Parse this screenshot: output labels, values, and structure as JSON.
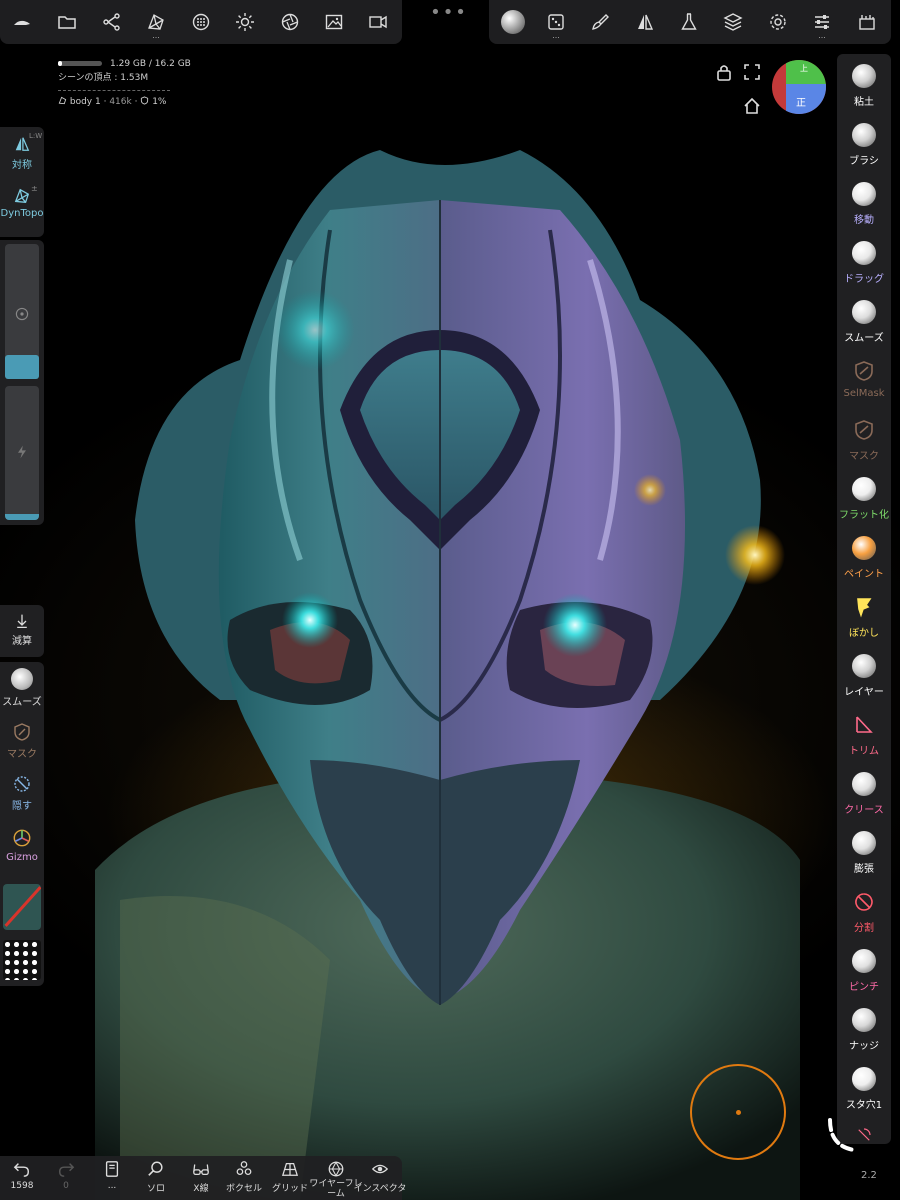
{
  "stats": {
    "memory": "1.29 GB / 16.2 GB",
    "memory_fraction": 0.08,
    "vertices": "シーンの頂点 : 1.53M",
    "object_name": "body 1",
    "object_info": "416k",
    "object_hidden": "1%"
  },
  "gizmo": {
    "top": "上",
    "front": "正"
  },
  "top_bar": {
    "ellipsis": "...",
    "grip": "•••"
  },
  "left": {
    "symmetry": {
      "label": "対称",
      "badge": "L:W"
    },
    "dyntopo": {
      "label": "DynTopo",
      "badge": "±"
    },
    "slider_value": 0.55,
    "decimate": "減算",
    "smooth": "スムーズ",
    "mask": "マスク",
    "hide": "隠す",
    "gizmo": "Gizmo"
  },
  "tools": [
    {
      "label": "粘土",
      "color": "#ffffff",
      "ball": "#cfcfcf"
    },
    {
      "label": "ブラシ",
      "color": "#ffffff",
      "ball": "#cfcfcf"
    },
    {
      "label": "移動",
      "color": "#b9b0ff",
      "ball": "#e8e8e8"
    },
    {
      "label": "ドラッグ",
      "color": "#b9b0ff",
      "ball": "#e8e8e8"
    },
    {
      "label": "スムーズ",
      "color": "#ffffff",
      "ball": "#dddddd"
    },
    {
      "label": "SelMask",
      "color": "#8a6a58",
      "ball": ""
    },
    {
      "label": "マスク",
      "color": "#8a6a58",
      "ball": ""
    },
    {
      "label": "フラット化",
      "color": "#7ddc6a",
      "ball": "#eeeeee"
    },
    {
      "label": "ペイント",
      "color": "#ffa04a",
      "ball": "#f7a041"
    },
    {
      "label": "ぼかし",
      "color": "#ffe45a",
      "ball": ""
    },
    {
      "label": "レイヤー",
      "color": "#ffffff",
      "ball": "#cfcfcf"
    },
    {
      "label": "トリム",
      "color": "#ff6a8a",
      "ball": ""
    },
    {
      "label": "クリース",
      "color": "#ff6aa8",
      "ball": "#e0e0e0"
    },
    {
      "label": "膨張",
      "color": "#ffffff",
      "ball": "#e0e0e0"
    },
    {
      "label": "分割",
      "color": "#ff5a6a",
      "ball": ""
    },
    {
      "label": "ピンチ",
      "color": "#ff6aa8",
      "ball": "#e0e0e0"
    },
    {
      "label": "ナッジ",
      "color": "#ffffff",
      "ball": "#d8d8d8"
    },
    {
      "label": "スタ穴1",
      "color": "#ffffff",
      "ball": "#eeeeee"
    }
  ],
  "bottom": {
    "undo_count": "1598",
    "redo_count": "0",
    "layers": "...",
    "solo": "ソロ",
    "xray": "X線",
    "voxel": "ボクセル",
    "grid": "グリッド",
    "wireframe": "ワイヤーフレーム",
    "inspector": "インスペクタ"
  },
  "stroke_radius": "2.2",
  "colors": {
    "panel": "#202022",
    "accent": "#4a9bb5",
    "cursor": "#e07a10"
  }
}
